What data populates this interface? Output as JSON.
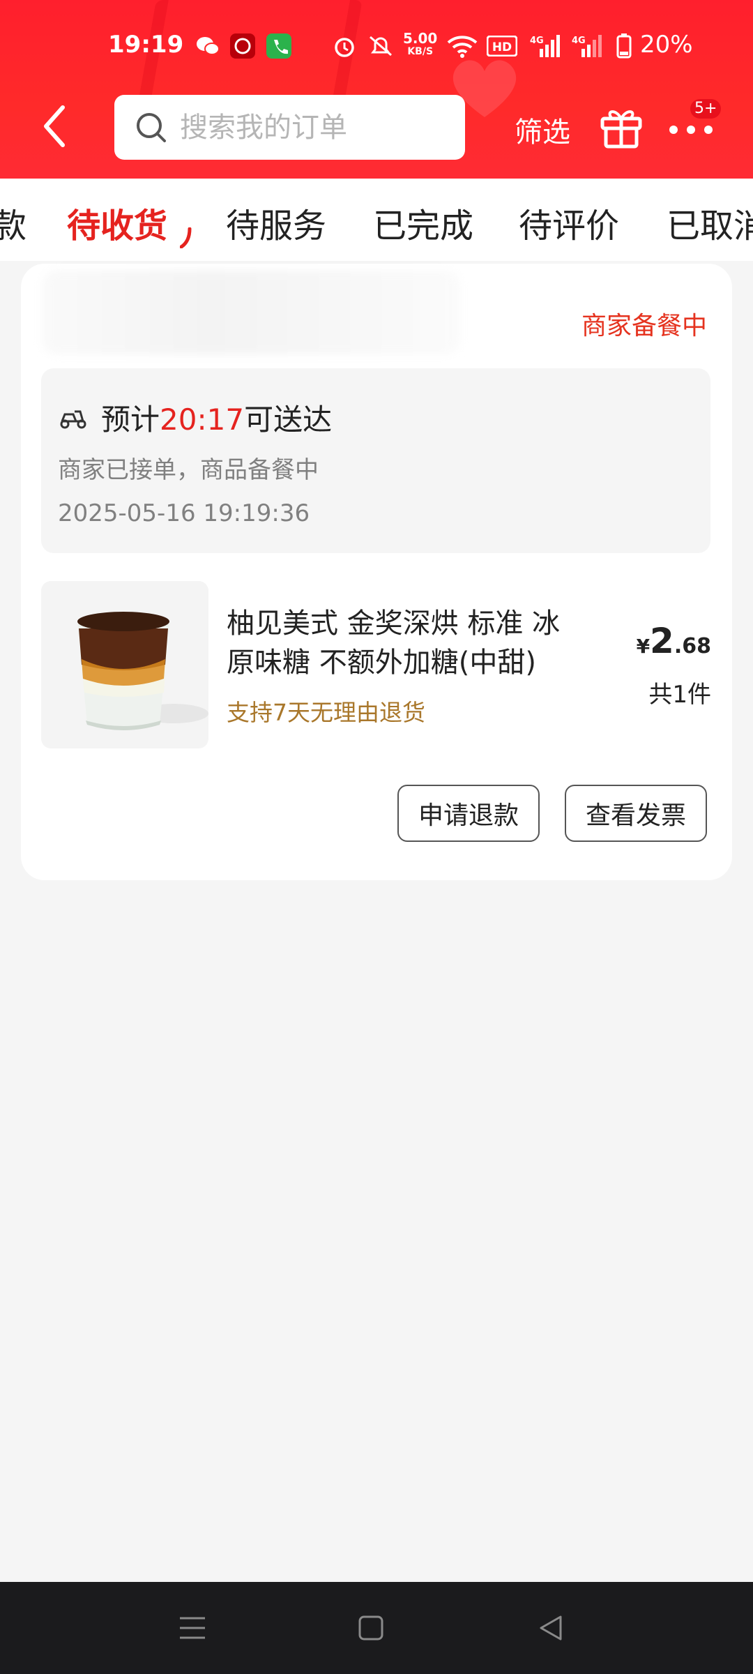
{
  "status_bar": {
    "time": "19:19",
    "speed_value": "5.00",
    "speed_unit": "KB/S",
    "battery": "20%",
    "hd_label": "HD",
    "net_label_1": "4G",
    "net_label_2": "4G"
  },
  "header": {
    "search_placeholder": "搜索我的订单",
    "filter_label": "筛选",
    "more_badge": "5+"
  },
  "tabs": [
    {
      "label": "款",
      "active": false
    },
    {
      "label": "待收货",
      "active": true
    },
    {
      "label": "待服务",
      "active": false
    },
    {
      "label": "已完成",
      "active": false
    },
    {
      "label": "待评价",
      "active": false
    },
    {
      "label": "已取消",
      "active": false
    }
  ],
  "order": {
    "status": "商家备餐中",
    "eta_prefix": "预计",
    "eta_time": "20:17",
    "eta_suffix": "可送达",
    "delivery_desc": "商家已接单，商品备餐中",
    "delivery_time": "2025-05-16 19:19:36",
    "product_name": "柚见美式 金奖深烘 标准 冰 原味糖 不额外加糖(中甜)",
    "return_note": "支持7天无理由退货",
    "price_symbol": "¥",
    "price_int": "2",
    "price_dec": ".68",
    "quantity": "共1件",
    "refund_button": "申请退款",
    "invoice_button": "查看发票"
  },
  "colors": {
    "header_red": "#ff2a2a",
    "accent_red": "#e5231f",
    "return_note_gold": "#a9772b"
  }
}
